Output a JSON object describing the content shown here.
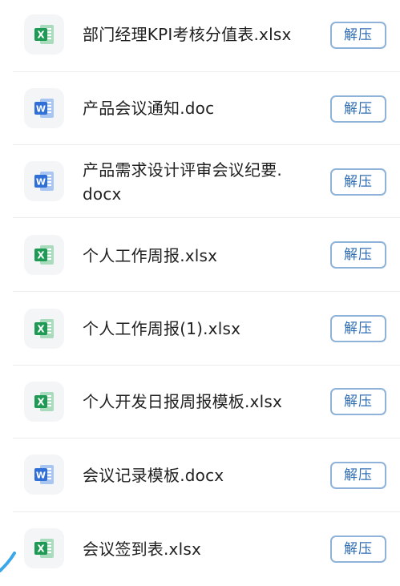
{
  "files": [
    {
      "name": "部门经理KPI考核分值表.xlsx",
      "type": "excel",
      "icon": "excel-icon",
      "action_label": "解压"
    },
    {
      "name": "产品会议通知.doc",
      "type": "word",
      "icon": "word-icon",
      "action_label": "解压"
    },
    {
      "name": "产品需求设计评审会议纪要.docx",
      "type": "word",
      "icon": "word-icon",
      "action_label": "解压"
    },
    {
      "name": "个人工作周报.xlsx",
      "type": "excel",
      "icon": "excel-icon",
      "action_label": "解压"
    },
    {
      "name": "个人工作周报(1).xlsx",
      "type": "excel",
      "icon": "excel-icon",
      "action_label": "解压"
    },
    {
      "name": "个人开发日报周报模板.xlsx",
      "type": "excel",
      "icon": "excel-icon",
      "action_label": "解压"
    },
    {
      "name": "会议记录模板.docx",
      "type": "word",
      "icon": "word-icon",
      "action_label": "解压"
    },
    {
      "name": "会议签到表.xlsx",
      "type": "excel",
      "icon": "excel-icon",
      "action_label": "解压"
    }
  ],
  "icon_letters": {
    "excel": "X",
    "word": "W"
  },
  "colors": {
    "excel": "#1e9a55",
    "excel_light": "#a8dcbc",
    "word": "#2f6fd6",
    "word_light": "#a9c6f2",
    "button_border": "#8fb3d8",
    "button_text": "#2f6eb5",
    "divider": "#ececec"
  }
}
